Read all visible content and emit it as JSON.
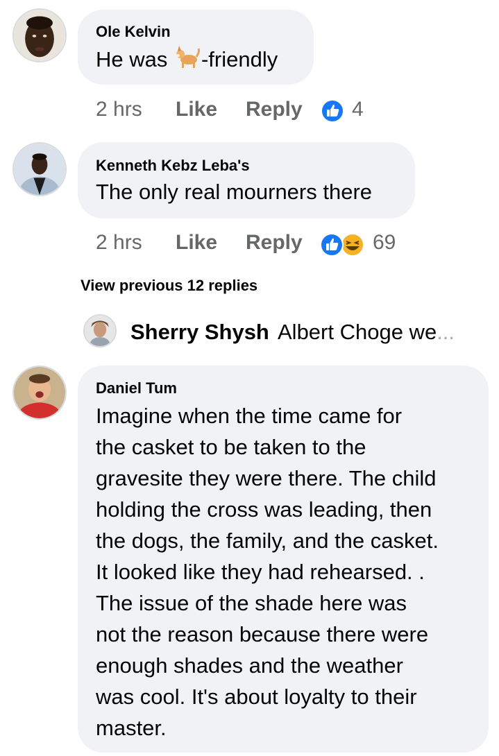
{
  "comments": [
    {
      "author": "Ole Kelvin",
      "text_before": "He was ",
      "emoji": "dog-emoji",
      "text_after": "-friendly",
      "time": "2 hrs",
      "like_label": "Like",
      "reply_label": "Reply",
      "reactions": [
        "like-icon"
      ],
      "reaction_count": "4"
    },
    {
      "author": "Kenneth Kebz Leba's",
      "text": "The only real mourners there",
      "time": "2 hrs",
      "like_label": "Like",
      "reply_label": "Reply",
      "reactions": [
        "like-icon",
        "laugh-icon"
      ],
      "reaction_count": "69"
    }
  ],
  "replies": {
    "view_previous_label": "View previous 12 replies",
    "preview": {
      "author": "Sherry Shysh",
      "text": "Albert Choge we",
      "ellipsis": "..."
    }
  },
  "long_comment": {
    "author": "Daniel Tum",
    "lines": [
      "Imagine when the time came for",
      "the casket to be taken to the",
      "gravesite they were there. The child",
      "holding the cross was leading, then",
      "the dogs, the family, and the casket.",
      "It looked like they had rehearsed. .",
      "The issue of the shade here was",
      "not the reason because there were",
      "enough shades and the weather",
      "was cool. It's about loyalty to their",
      "master."
    ]
  },
  "colors": {
    "bubble": "#f0f2f5",
    "meta": "#65676b",
    "like_blue": "#1877f2",
    "laugh_yellow": "#f7b125"
  }
}
